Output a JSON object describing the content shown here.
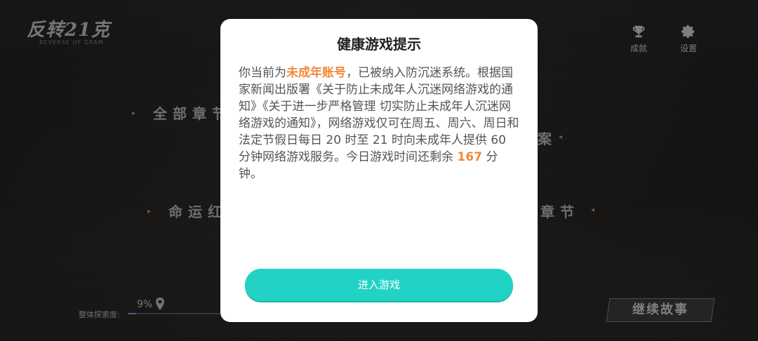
{
  "background": {
    "logo": "反转21克",
    "logo_sub": "REVERSE OF GRAM",
    "menu": {
      "all_chapters": "全部章节",
      "item_right_top": "案",
      "fate": "命运红",
      "chapter_right": "章节"
    },
    "top_icons": {
      "achievements": {
        "icon": "trophy-icon",
        "label": "成就"
      },
      "settings": {
        "icon": "gear-icon",
        "label": "设置"
      }
    },
    "progress": {
      "label": "整体探索度:",
      "value_text": "9%",
      "value": 0.09
    },
    "continue_button": "继续故事"
  },
  "dialog": {
    "title": "健康游戏提示",
    "body": {
      "p1": "你当前为",
      "highlight_account": "未成年账号",
      "p2": "，已被纳入防沉迷系统。根据国家新闻出版署《关于防止未成年人沉迷网络游戏的通知》《关于进一步严格管理 切实防止未成年人沉迷网络游戏的通知》，网络游戏仅可在周五、周六、周日和法定节假日每日 20 时至 21 时向未成年人提供 60 分钟网络游戏服务。今日游戏时间还剩余",
      "highlight_minutes": "167",
      "p3": "分钟。"
    },
    "enter_button": "进入游戏"
  },
  "colors": {
    "accent_button": "#22d3c5",
    "highlight": "#f08a3c"
  }
}
